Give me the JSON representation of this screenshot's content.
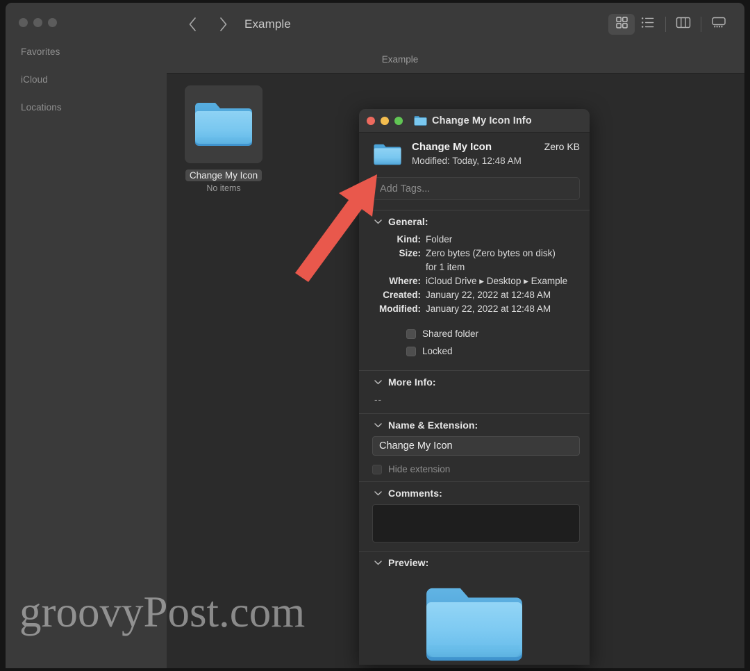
{
  "window": {
    "traffic_lights": [
      "close",
      "minimize",
      "zoom"
    ]
  },
  "sidebar": {
    "sections": [
      {
        "label": "Favorites"
      },
      {
        "label": "iCloud"
      },
      {
        "label": "Locations"
      }
    ]
  },
  "toolbar": {
    "back_icon": "chevron-left-icon",
    "forward_icon": "chevron-right-icon",
    "title": "Example",
    "views": [
      {
        "name": "icon-view",
        "icon": "grid-icon",
        "active": true
      },
      {
        "name": "list-view",
        "icon": "list-icon",
        "active": false
      },
      {
        "name": "column-view",
        "icon": "columns-icon",
        "active": false
      },
      {
        "name": "gallery-view",
        "icon": "gallery-icon",
        "active": false
      }
    ]
  },
  "pathbar": {
    "label": "Example"
  },
  "files": [
    {
      "name": "Change My Icon",
      "subtitle": "No items",
      "icon": "folder-icon",
      "selected": true
    }
  ],
  "info_window": {
    "title": "Change My Icon Info",
    "title_icon": "folder-icon",
    "traffic_lights": [
      {
        "name": "close",
        "color": "#ed6a5e"
      },
      {
        "name": "minimize",
        "color": "#f4bd4f"
      },
      {
        "name": "zoom",
        "color": "#61c554"
      }
    ],
    "header": {
      "icon": "folder-icon",
      "name": "Change My Icon",
      "size": "Zero KB",
      "modified": "Modified: Today, 12:48 AM"
    },
    "tags": {
      "placeholder": "Add Tags...",
      "value": ""
    },
    "sections": {
      "general": {
        "label": "General:",
        "rows": [
          {
            "key": "Kind:",
            "value": "Folder"
          },
          {
            "key": "Size:",
            "value": "Zero bytes (Zero bytes on disk)"
          },
          {
            "key": "",
            "value": "for 1 item"
          },
          {
            "key": "Where:",
            "value": "iCloud Drive ▸ Desktop ▸ Example"
          },
          {
            "key": "Created:",
            "value": "January 22, 2022 at 12:48 AM"
          },
          {
            "key": "Modified:",
            "value": "January 22, 2022 at 12:48 AM"
          }
        ],
        "checkboxes": [
          {
            "label": "Shared folder",
            "checked": false,
            "disabled": false
          },
          {
            "label": "Locked",
            "checked": false,
            "disabled": false
          }
        ]
      },
      "more_info": {
        "label": "More Info:",
        "value": "--"
      },
      "name_extension": {
        "label": "Name & Extension:",
        "field_value": "Change My Icon",
        "hide_extension_label": "Hide extension",
        "hide_extension_checked": false
      },
      "comments": {
        "label": "Comments:",
        "value": ""
      },
      "preview": {
        "label": "Preview:",
        "icon": "folder-icon"
      }
    }
  },
  "annotation": {
    "arrow_color": "#e9584c",
    "arrow_name": "red-arrow-pointing-to-folder-icon"
  },
  "watermark": {
    "text": "groovyPost.com"
  },
  "colors": {
    "window_bg": "#2b2b2b",
    "sidebar_bg": "#3a3a3a",
    "toolbar_bg": "#3a3a3a",
    "info_bg": "#2e2e2e",
    "folder_front": "#74c4ef",
    "folder_back": "#4ba3d8",
    "accent_red": "#e9584c"
  }
}
